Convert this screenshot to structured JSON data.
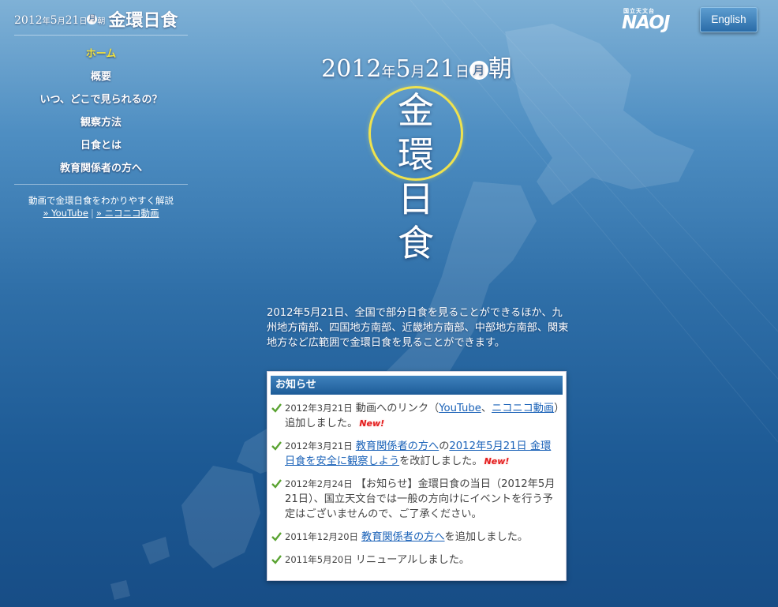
{
  "site": {
    "title_date": "2012",
    "title_year_kanji": "年",
    "title_month": "5",
    "title_month_kanji": "月",
    "title_day": "21",
    "title_day_kanji": "日",
    "title_weekday": "月",
    "title_morning": "朝",
    "title_main": "金環日食"
  },
  "nav": {
    "items": [
      {
        "label": "ホーム",
        "active": true
      },
      {
        "label": "概要"
      },
      {
        "label": "いつ、どこで見られるの？"
      },
      {
        "label": "観察方法"
      },
      {
        "label": "日食とは"
      },
      {
        "label": "教育関係者の方へ"
      }
    ]
  },
  "video": {
    "text": "動画で金環日食をわかりやすく解説",
    "youtube": "» YouTube",
    "separator": "|",
    "niconico": "» ニコニコ動画"
  },
  "header": {
    "logo_small": "国立天文台",
    "logo_big": "NAOJ",
    "english_button": "English"
  },
  "hero": {
    "year": "2012",
    "year_kanji": "年",
    "month": "5",
    "month_kanji": "月",
    "day": "21",
    "day_kanji": "日",
    "weekday": "月",
    "morning": "朝",
    "title_chars": [
      "金",
      "環",
      "日",
      "食"
    ],
    "intro": "2012年5月21日、全国で部分日食を見ることができるほか、九州地方南部、四国地方南部、近畿地方南部、中部地方南部、関東地方など広範囲で金環日食を見ることができます。"
  },
  "news": {
    "heading": "お知らせ",
    "items": [
      {
        "date": "2012年3月21日",
        "t1": "動画へのリンク（",
        "l1": "YouTube",
        "t2": "、",
        "l2": "ニコニコ動画",
        "t3": "）追加しました。",
        "new": "New!"
      },
      {
        "date": "2012年3月21日",
        "l1": "教育関係者の方へ",
        "t1": "の",
        "l2": "2012年5月21日 金環日食を安全に観察しよう",
        "t2": "を改訂しました。",
        "new": "New!"
      },
      {
        "date": "2012年2月24日",
        "text": "【お知らせ】金環日食の当日（2012年5月21日）、国立天文台では一般の方向けにイベントを行う予定はございませんので、ご了承ください。"
      },
      {
        "date": "2011年12月20日",
        "l1": "教育関係者の方へ",
        "t1": "を追加しました。"
      },
      {
        "date": "2011年5月20日",
        "text": "リニューアルしました。"
      }
    ]
  },
  "colors": {
    "nav_active": "#f3e23c",
    "ring": "#efe24e",
    "link": "#1a62b8",
    "new_badge": "#e31e1e",
    "news_header": "#2a6ca8",
    "check": "#5aa332"
  }
}
